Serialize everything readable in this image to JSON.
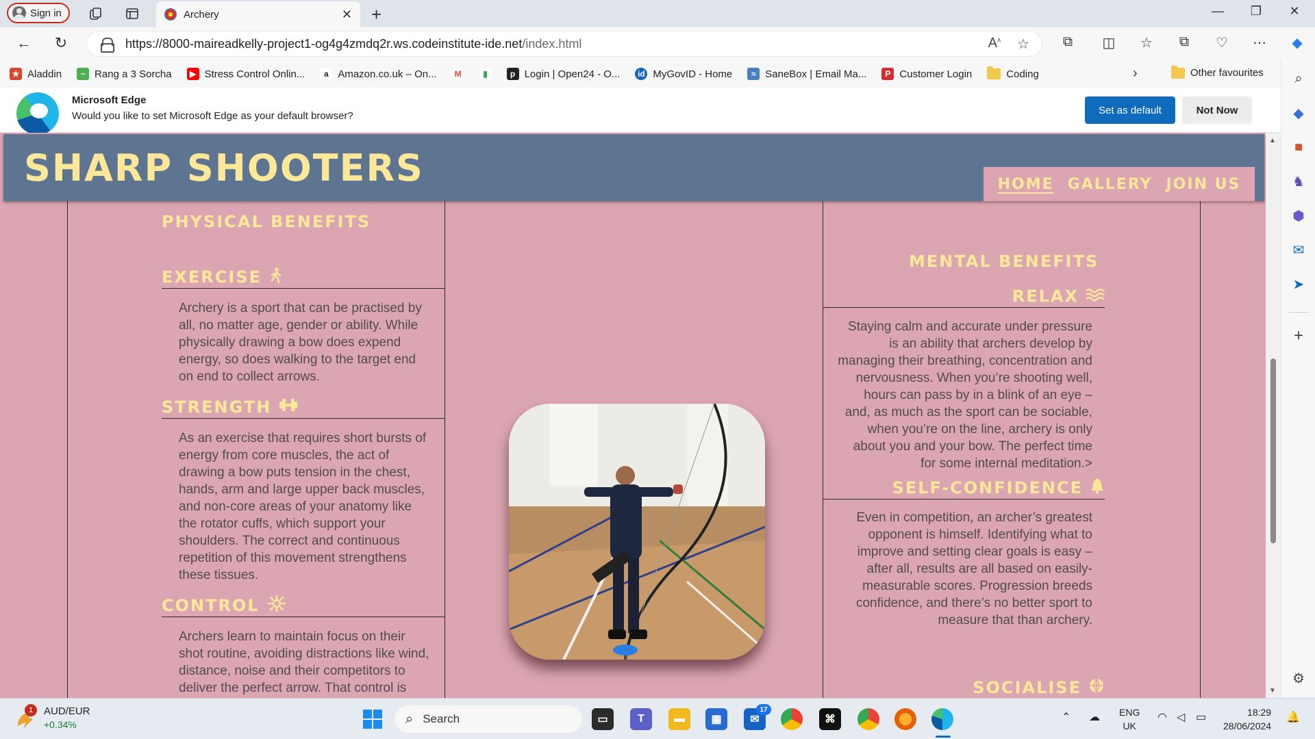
{
  "browser": {
    "signin_label": "Sign in",
    "tab_title": "Archery",
    "url_main": "https://8000-maireadkelly-project1-og4g4zmdq2r.ws.codeinstitute-ide.net",
    "url_path": "/index.html"
  },
  "favourites": [
    {
      "label": "Aladdin",
      "icon": "aladdin-icon",
      "color": "#d9452b"
    },
    {
      "label": "Rang a 3 Sorcha",
      "icon": "bird-icon",
      "color": "#4caf50"
    },
    {
      "label": "Stress Control Onlin...",
      "icon": "youtube-icon",
      "color": "#ff0000"
    },
    {
      "label": "Amazon.co.uk – On...",
      "icon": "amazon-icon",
      "color": "#222222"
    },
    {
      "label": "",
      "icon": "gmail-icon",
      "color": "#ea4335"
    },
    {
      "label": "",
      "icon": "chart-icon",
      "color": "#34a853"
    },
    {
      "label": "Login | Open24 - O...",
      "icon": "open24-icon",
      "color": "#222222"
    },
    {
      "label": "MyGovID - Home",
      "icon": "mygovid-icon",
      "color": "#1565c0"
    },
    {
      "label": "SaneBox | Email Ma...",
      "icon": "sanebox-icon",
      "color": "#4a7fbf"
    },
    {
      "label": "Customer Login",
      "icon": "customer-icon",
      "color": "#d32f2f"
    },
    {
      "label": "Coding",
      "icon": "folder-icon",
      "color": "#f2c94c"
    }
  ],
  "other_favourites": "Other favourites",
  "infobar": {
    "title": "Microsoft Edge",
    "message": "Would you like to set Microsoft Edge as your default browser?",
    "set_default": "Set as default",
    "not_now": "Not Now"
  },
  "site": {
    "brand": "SHARP SHOOTERS",
    "nav": [
      "HOME",
      "GALLERY",
      "JOIN US"
    ],
    "physical": {
      "title": "PHYSICAL BENEFITS",
      "items": [
        {
          "heading": "EXERCISE",
          "icon": "walking-icon",
          "text": "Archery is a sport that can be practised by all, no matter age, gender or ability. While physically drawing a bow does expend energy, so does walking to the target end on end to collect arrows."
        },
        {
          "heading": "STRENGTH",
          "icon": "dumbbell-icon",
          "text": "As an exercise that requires short bursts of energy from core muscles, the act of drawing a bow puts tension in the chest, hands, arm and large upper back muscles, and non-core areas of your anatomy like the rotator cuffs, which support your shoulders. The correct and continuous repetition of this movement strengthens these tissues."
        },
        {
          "heading": "CONTROL",
          "icon": "burst-icon",
          "text": "Archers learn to maintain focus on their shot routine, avoiding distractions like wind, distance, noise and their competitors to deliver the perfect arrow. That control is"
        }
      ]
    },
    "mental": {
      "title": "MENTAL BENEFITS",
      "items": [
        {
          "heading": "RELAX",
          "icon": "waves-icon",
          "text": "Staying calm and accurate under pressure is an ability that archers develop by managing their breathing, concentration and nervousness. When you’re shooting well, hours can pass by in a blink of an eye – and, as much as the sport can be sociable, when you’re on the line, archery is only about you and your bow. The perfect time for some internal meditation.>"
        },
        {
          "heading": "SELF-CONFIDENCE",
          "icon": "bell-icon",
          "text": "Even in competition, an archer’s greatest opponent is himself. Identifying what to improve and setting clear goals is easy – after all, results are all based on easily-measurable scores. Progression breeds confidence, and there’s no better sport to measure that than archery."
        },
        {
          "heading": "SOCIALISE",
          "icon": "globe-icon",
          "text": ""
        }
      ]
    }
  },
  "taskbar": {
    "weather_badge": "1",
    "currency": "AUD/EUR",
    "change": "+0.34%",
    "search": "Search",
    "teams_badge": "17",
    "lang1": "ENG",
    "lang2": "UK",
    "time": "18:29",
    "date": "28/06/2024"
  },
  "colors": {
    "page_bg": "#dba5b2",
    "header_bg": "#5d7591",
    "accent": "#fde89a",
    "body_text": "#514c4f"
  }
}
